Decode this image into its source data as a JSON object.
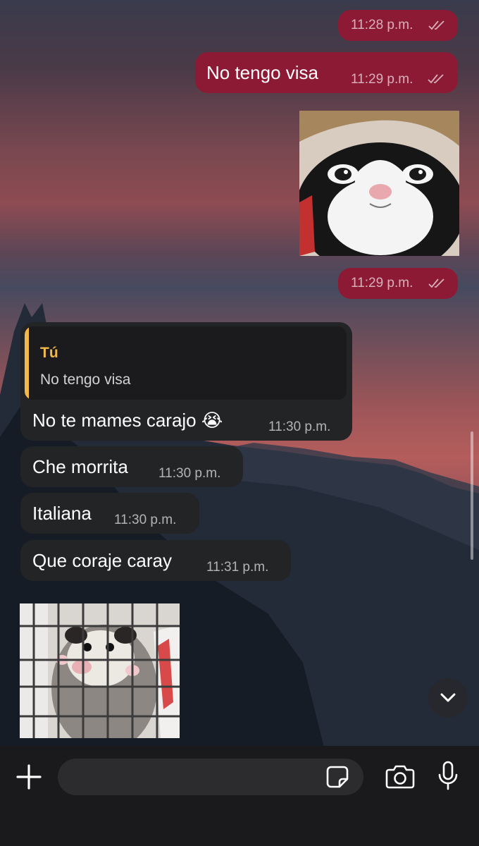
{
  "colors": {
    "outgoing_bubble": "#8d1a35",
    "incoming_bubble": "#232426",
    "reply_accent": "#f2b84b",
    "composer_bg": "#1a1a1c"
  },
  "messages": {
    "out1": {
      "time": "11:28 p.m."
    },
    "out2": {
      "text": "No tengo visa",
      "time": "11:29 p.m."
    },
    "out3": {
      "image": "cat-photo",
      "time": "11:29 p.m."
    },
    "in1": {
      "reply_author": "Tú",
      "reply_text": "No tengo visa",
      "text": "No te mames carajo",
      "emoji": "😭",
      "time": "11:30 p.m."
    },
    "in2": {
      "text": "Che morrita",
      "time": "11:30 p.m."
    },
    "in3": {
      "text": "Italiana",
      "time": "11:30 p.m."
    },
    "in4": {
      "text": "Que coraje caray",
      "time": "11:31 p.m."
    },
    "in5": {
      "image": "opossum-photo"
    }
  },
  "composer": {
    "icons": [
      "plus-icon",
      "sticker-icon",
      "camera-icon",
      "microphone-icon"
    ]
  },
  "scroll_down_icon": "chevron-down-icon"
}
